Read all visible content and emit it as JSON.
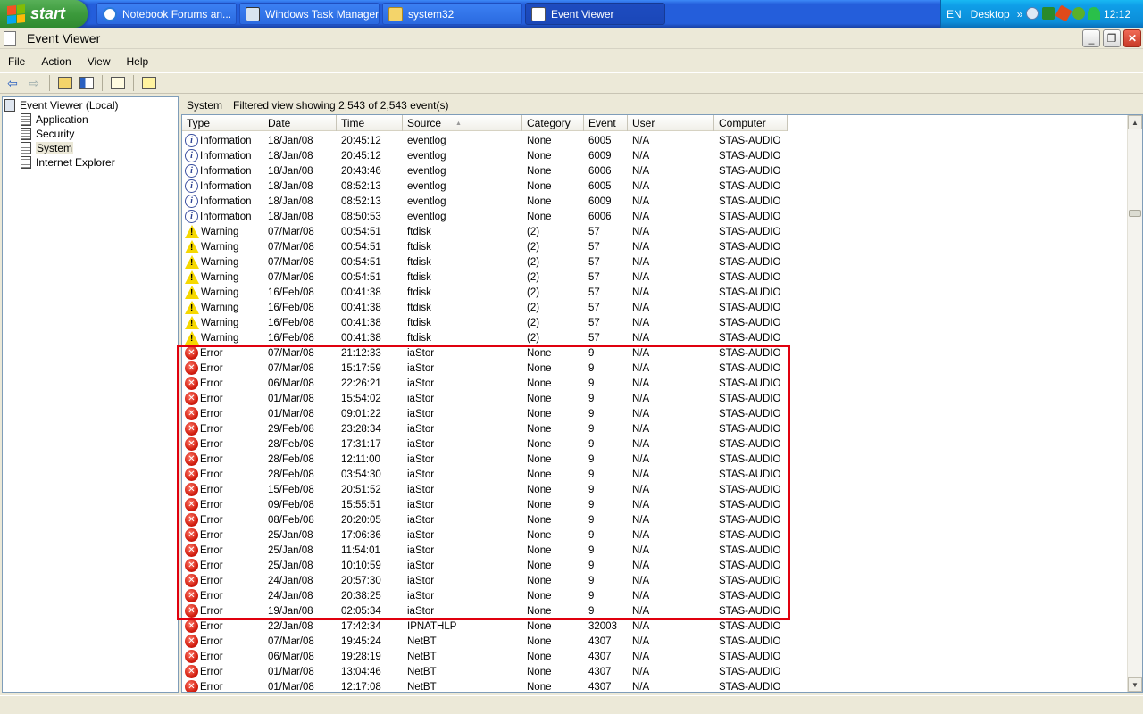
{
  "taskbar": {
    "start_label": "start",
    "buttons": [
      {
        "label": "Notebook Forums an...",
        "icon": "ie-icon"
      },
      {
        "label": "Windows Task Manager",
        "icon": "task-manager-icon"
      },
      {
        "label": "system32",
        "icon": "folder-icon"
      },
      {
        "label": "Event Viewer",
        "icon": "event-viewer-icon"
      }
    ],
    "tray": {
      "language": "EN",
      "desktop": "Desktop",
      "chevron": "»",
      "clock": "12:12"
    }
  },
  "window": {
    "title": "Event Viewer",
    "controls": {
      "minimize": "_",
      "maximize": "❐",
      "close": "✕"
    }
  },
  "menu": [
    "File",
    "Action",
    "View",
    "Help"
  ],
  "tree": {
    "root": "Event Viewer (Local)",
    "items": [
      "Application",
      "Security",
      "System",
      "Internet Explorer"
    ],
    "selected": "System"
  },
  "panel": {
    "crumb": "System",
    "status": "Filtered view showing 2,543 of 2,543 event(s)"
  },
  "columns": [
    "Type",
    "Date",
    "Time",
    "Source",
    "Category",
    "Event",
    "User",
    "Computer"
  ],
  "sort_indicator": "▲",
  "colors": {
    "highlight": "#e0000e",
    "error": "#d31f10",
    "warning": "#f6d800"
  },
  "rows": [
    {
      "type": "Information",
      "date": "18/Jan/08",
      "time": "20:45:12",
      "source": "eventlog",
      "category": "None",
      "event": "6005",
      "user": "N/A",
      "computer": "STAS-AUDIO"
    },
    {
      "type": "Information",
      "date": "18/Jan/08",
      "time": "20:45:12",
      "source": "eventlog",
      "category": "None",
      "event": "6009",
      "user": "N/A",
      "computer": "STAS-AUDIO"
    },
    {
      "type": "Information",
      "date": "18/Jan/08",
      "time": "20:43:46",
      "source": "eventlog",
      "category": "None",
      "event": "6006",
      "user": "N/A",
      "computer": "STAS-AUDIO"
    },
    {
      "type": "Information",
      "date": "18/Jan/08",
      "time": "08:52:13",
      "source": "eventlog",
      "category": "None",
      "event": "6005",
      "user": "N/A",
      "computer": "STAS-AUDIO"
    },
    {
      "type": "Information",
      "date": "18/Jan/08",
      "time": "08:52:13",
      "source": "eventlog",
      "category": "None",
      "event": "6009",
      "user": "N/A",
      "computer": "STAS-AUDIO"
    },
    {
      "type": "Information",
      "date": "18/Jan/08",
      "time": "08:50:53",
      "source": "eventlog",
      "category": "None",
      "event": "6006",
      "user": "N/A",
      "computer": "STAS-AUDIO"
    },
    {
      "type": "Warning",
      "date": "07/Mar/08",
      "time": "00:54:51",
      "source": "ftdisk",
      "category": "(2)",
      "event": "57",
      "user": "N/A",
      "computer": "STAS-AUDIO"
    },
    {
      "type": "Warning",
      "date": "07/Mar/08",
      "time": "00:54:51",
      "source": "ftdisk",
      "category": "(2)",
      "event": "57",
      "user": "N/A",
      "computer": "STAS-AUDIO"
    },
    {
      "type": "Warning",
      "date": "07/Mar/08",
      "time": "00:54:51",
      "source": "ftdisk",
      "category": "(2)",
      "event": "57",
      "user": "N/A",
      "computer": "STAS-AUDIO"
    },
    {
      "type": "Warning",
      "date": "07/Mar/08",
      "time": "00:54:51",
      "source": "ftdisk",
      "category": "(2)",
      "event": "57",
      "user": "N/A",
      "computer": "STAS-AUDIO"
    },
    {
      "type": "Warning",
      "date": "16/Feb/08",
      "time": "00:41:38",
      "source": "ftdisk",
      "category": "(2)",
      "event": "57",
      "user": "N/A",
      "computer": "STAS-AUDIO"
    },
    {
      "type": "Warning",
      "date": "16/Feb/08",
      "time": "00:41:38",
      "source": "ftdisk",
      "category": "(2)",
      "event": "57",
      "user": "N/A",
      "computer": "STAS-AUDIO"
    },
    {
      "type": "Warning",
      "date": "16/Feb/08",
      "time": "00:41:38",
      "source": "ftdisk",
      "category": "(2)",
      "event": "57",
      "user": "N/A",
      "computer": "STAS-AUDIO"
    },
    {
      "type": "Warning",
      "date": "16/Feb/08",
      "time": "00:41:38",
      "source": "ftdisk",
      "category": "(2)",
      "event": "57",
      "user": "N/A",
      "computer": "STAS-AUDIO"
    },
    {
      "type": "Error",
      "date": "07/Mar/08",
      "time": "21:12:33",
      "source": "iaStor",
      "category": "None",
      "event": "9",
      "user": "N/A",
      "computer": "STAS-AUDIO"
    },
    {
      "type": "Error",
      "date": "07/Mar/08",
      "time": "15:17:59",
      "source": "iaStor",
      "category": "None",
      "event": "9",
      "user": "N/A",
      "computer": "STAS-AUDIO"
    },
    {
      "type": "Error",
      "date": "06/Mar/08",
      "time": "22:26:21",
      "source": "iaStor",
      "category": "None",
      "event": "9",
      "user": "N/A",
      "computer": "STAS-AUDIO"
    },
    {
      "type": "Error",
      "date": "01/Mar/08",
      "time": "15:54:02",
      "source": "iaStor",
      "category": "None",
      "event": "9",
      "user": "N/A",
      "computer": "STAS-AUDIO"
    },
    {
      "type": "Error",
      "date": "01/Mar/08",
      "time": "09:01:22",
      "source": "iaStor",
      "category": "None",
      "event": "9",
      "user": "N/A",
      "computer": "STAS-AUDIO"
    },
    {
      "type": "Error",
      "date": "29/Feb/08",
      "time": "23:28:34",
      "source": "iaStor",
      "category": "None",
      "event": "9",
      "user": "N/A",
      "computer": "STAS-AUDIO"
    },
    {
      "type": "Error",
      "date": "28/Feb/08",
      "time": "17:31:17",
      "source": "iaStor",
      "category": "None",
      "event": "9",
      "user": "N/A",
      "computer": "STAS-AUDIO"
    },
    {
      "type": "Error",
      "date": "28/Feb/08",
      "time": "12:11:00",
      "source": "iaStor",
      "category": "None",
      "event": "9",
      "user": "N/A",
      "computer": "STAS-AUDIO"
    },
    {
      "type": "Error",
      "date": "28/Feb/08",
      "time": "03:54:30",
      "source": "iaStor",
      "category": "None",
      "event": "9",
      "user": "N/A",
      "computer": "STAS-AUDIO"
    },
    {
      "type": "Error",
      "date": "15/Feb/08",
      "time": "20:51:52",
      "source": "iaStor",
      "category": "None",
      "event": "9",
      "user": "N/A",
      "computer": "STAS-AUDIO"
    },
    {
      "type": "Error",
      "date": "09/Feb/08",
      "time": "15:55:51",
      "source": "iaStor",
      "category": "None",
      "event": "9",
      "user": "N/A",
      "computer": "STAS-AUDIO"
    },
    {
      "type": "Error",
      "date": "08/Feb/08",
      "time": "20:20:05",
      "source": "iaStor",
      "category": "None",
      "event": "9",
      "user": "N/A",
      "computer": "STAS-AUDIO"
    },
    {
      "type": "Error",
      "date": "25/Jan/08",
      "time": "17:06:36",
      "source": "iaStor",
      "category": "None",
      "event": "9",
      "user": "N/A",
      "computer": "STAS-AUDIO"
    },
    {
      "type": "Error",
      "date": "25/Jan/08",
      "time": "11:54:01",
      "source": "iaStor",
      "category": "None",
      "event": "9",
      "user": "N/A",
      "computer": "STAS-AUDIO"
    },
    {
      "type": "Error",
      "date": "25/Jan/08",
      "time": "10:10:59",
      "source": "iaStor",
      "category": "None",
      "event": "9",
      "user": "N/A",
      "computer": "STAS-AUDIO"
    },
    {
      "type": "Error",
      "date": "24/Jan/08",
      "time": "20:57:30",
      "source": "iaStor",
      "category": "None",
      "event": "9",
      "user": "N/A",
      "computer": "STAS-AUDIO"
    },
    {
      "type": "Error",
      "date": "24/Jan/08",
      "time": "20:38:25",
      "source": "iaStor",
      "category": "None",
      "event": "9",
      "user": "N/A",
      "computer": "STAS-AUDIO"
    },
    {
      "type": "Error",
      "date": "19/Jan/08",
      "time": "02:05:34",
      "source": "iaStor",
      "category": "None",
      "event": "9",
      "user": "N/A",
      "computer": "STAS-AUDIO"
    },
    {
      "type": "Error",
      "date": "22/Jan/08",
      "time": "17:42:34",
      "source": "IPNATHLP",
      "category": "None",
      "event": "32003",
      "user": "N/A",
      "computer": "STAS-AUDIO"
    },
    {
      "type": "Error",
      "date": "07/Mar/08",
      "time": "19:45:24",
      "source": "NetBT",
      "category": "None",
      "event": "4307",
      "user": "N/A",
      "computer": "STAS-AUDIO"
    },
    {
      "type": "Error",
      "date": "06/Mar/08",
      "time": "19:28:19",
      "source": "NetBT",
      "category": "None",
      "event": "4307",
      "user": "N/A",
      "computer": "STAS-AUDIO"
    },
    {
      "type": "Error",
      "date": "01/Mar/08",
      "time": "13:04:46",
      "source": "NetBT",
      "category": "None",
      "event": "4307",
      "user": "N/A",
      "computer": "STAS-AUDIO"
    },
    {
      "type": "Error",
      "date": "01/Mar/08",
      "time": "12:17:08",
      "source": "NetBT",
      "category": "None",
      "event": "4307",
      "user": "N/A",
      "computer": "STAS-AUDIO"
    }
  ]
}
